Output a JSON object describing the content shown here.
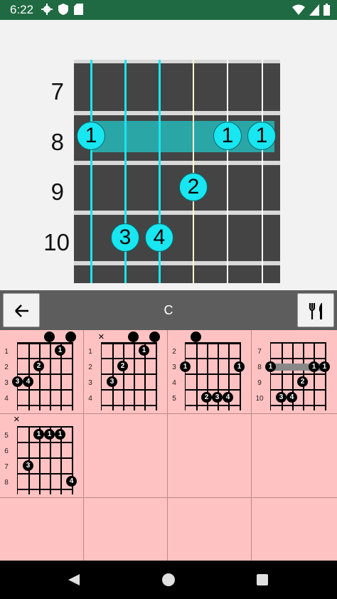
{
  "status_bar": {
    "time": "6:22",
    "left_icons": [
      "gear-icon",
      "shield-icon",
      "sd-card-icon"
    ],
    "right_icons": [
      "wifi-icon",
      "signal-icon",
      "battery-icon"
    ],
    "color": "#1f6a42"
  },
  "main_diagram": {
    "fret_labels": [
      "7",
      "8",
      "9",
      "10"
    ],
    "fingers": [
      "1",
      "1",
      "1",
      "2",
      "3",
      "4"
    ],
    "string_colors": [
      "#18e6f0",
      "#18e6f0",
      "#18e6f0",
      "#fffacd",
      "#ffffff",
      "#ffffff"
    ],
    "highlight_color": "#18e6f0"
  },
  "toolbar": {
    "back_icon": "arrow-left-icon",
    "title": "C",
    "tools_icon": "fork-knife-icon"
  },
  "chords": [
    {
      "frets": [
        "1",
        "2",
        "3",
        "4"
      ],
      "mute": "",
      "open_marks": 2,
      "fingers": [
        "1",
        "2",
        "3",
        "4"
      ]
    },
    {
      "frets": [
        "1",
        "2",
        "3",
        "4"
      ],
      "mute": "×",
      "open_marks": 2,
      "fingers": [
        "1",
        "2",
        "3"
      ]
    },
    {
      "frets": [
        "2",
        "3",
        "4",
        "5"
      ],
      "mute": "",
      "open_marks": 1,
      "fingers": [
        "1",
        "1",
        "2",
        "3",
        "4"
      ]
    },
    {
      "frets": [
        "7",
        "8",
        "9",
        "10"
      ],
      "mute": "",
      "open_marks": 0,
      "fingers": [
        "1",
        "1",
        "1",
        "2",
        "3",
        "4"
      ]
    },
    {
      "frets": [
        "5",
        "6",
        "7",
        "8"
      ],
      "mute": "×",
      "open_marks": 0,
      "fingers": [
        "1",
        "1",
        "1",
        "3",
        "4"
      ]
    }
  ],
  "grid_background": "#ffc2c2",
  "nav_bar": {
    "back_icon": "nav-back-icon",
    "home_icon": "nav-home-icon",
    "recents_icon": "nav-recents-icon"
  }
}
